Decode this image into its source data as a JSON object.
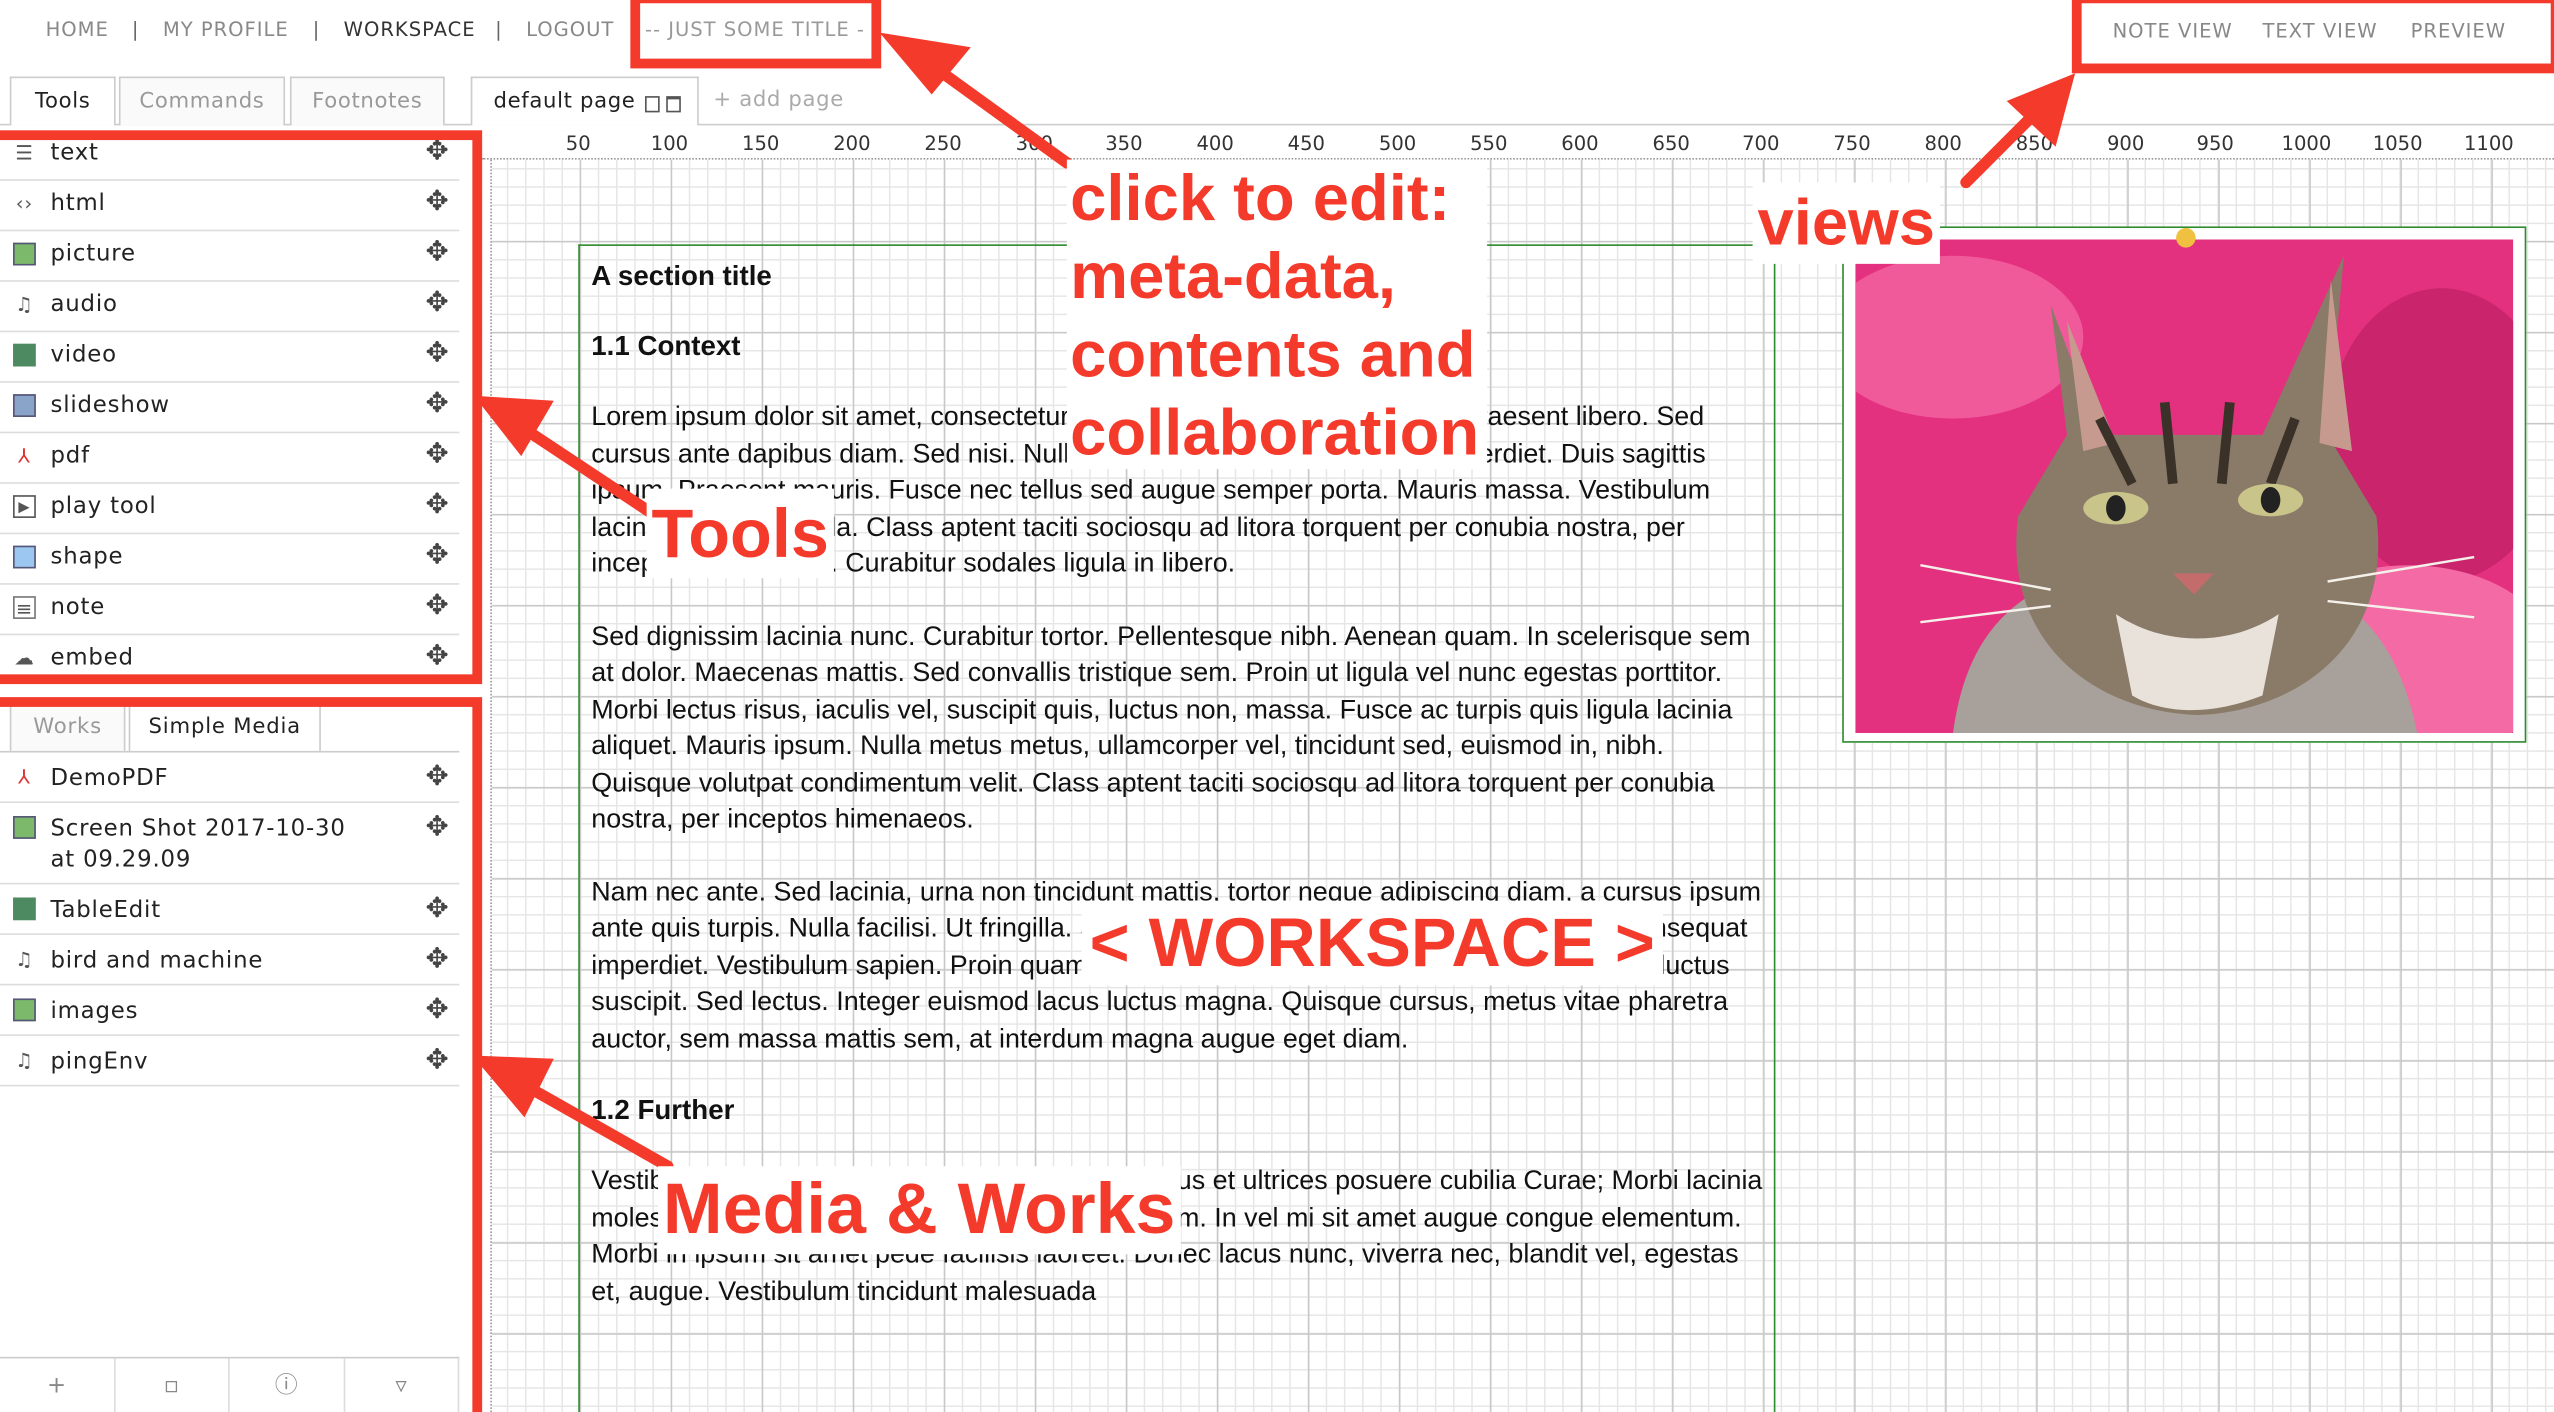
{
  "nav": {
    "home": "HOME",
    "my_profile": "MY PROFILE",
    "workspace": "WORKSPACE",
    "logout": "LOGOUT",
    "separator": "|",
    "title": "-- JUST SOME TITLE -"
  },
  "views": {
    "note_view": "NOTE VIEW",
    "text_view": "TEXT VIEW",
    "preview": "PREVIEW"
  },
  "sidebar_tabs": [
    "Tools",
    "Commands",
    "Footnotes"
  ],
  "page_tabs": {
    "current": "default page",
    "add": "+ add page"
  },
  "tools": [
    {
      "label": "text",
      "icon": "text-icon"
    },
    {
      "label": "html",
      "icon": "html-icon"
    },
    {
      "label": "picture",
      "icon": "picture-icon"
    },
    {
      "label": "audio",
      "icon": "audio-icon"
    },
    {
      "label": "video",
      "icon": "video-icon"
    },
    {
      "label": "slideshow",
      "icon": "slideshow-icon"
    },
    {
      "label": "pdf",
      "icon": "pdf-icon"
    },
    {
      "label": "play tool",
      "icon": "play-icon"
    },
    {
      "label": "shape",
      "icon": "shape-icon"
    },
    {
      "label": "note",
      "icon": "note-icon"
    },
    {
      "label": "embed",
      "icon": "embed-icon"
    }
  ],
  "media_tabs": [
    "Works",
    "Simple Media"
  ],
  "media": [
    {
      "label": "DemoPDF",
      "icon": "pdf-icon"
    },
    {
      "label": "Screen Shot 2017-10-30 at 09.29.09",
      "icon": "picture-icon"
    },
    {
      "label": "TableEdit",
      "icon": "video-icon"
    },
    {
      "label": "bird and machine",
      "icon": "audio-icon"
    },
    {
      "label": "images",
      "icon": "picture-icon"
    },
    {
      "label": "pingEnv",
      "icon": "audio-icon"
    }
  ],
  "ruler_ticks": [
    "50",
    "100",
    "150",
    "200",
    "250",
    "300",
    "350",
    "400",
    "450",
    "500",
    "550",
    "600",
    "650",
    "700",
    "750",
    "800",
    "850",
    "900",
    "950",
    "1000",
    "1050",
    "1100"
  ],
  "document": {
    "section_title": "A section title",
    "subsection_1": "1.1 Context",
    "paragraph_1": "Lorem ipsum dolor sit amet, consectetur adipiscing elit. Integer nec odio. Praesent libero. Sed cursus ante dapibus diam. Sed nisi. Nulla quis sem at nibh elementum imperdiet. Duis sagittis ipsum. Praesent mauris. Fusce nec tellus sed augue semper porta. Mauris massa. Vestibulum lacinia arcu eget nulla. Class aptent taciti sociosqu ad litora torquent per conubia nostra, per inceptos himenaeos. Curabitur sodales ligula in libero.",
    "paragraph_2": "Sed dignissim lacinia nunc. Curabitur tortor. Pellentesque nibh. Aenean quam. In scelerisque sem at dolor. Maecenas mattis. Sed convallis tristique sem. Proin ut ligula vel nunc egestas porttitor. Morbi lectus risus, iaculis vel, suscipit quis, luctus non, massa. Fusce ac turpis quis ligula lacinia aliquet. Mauris ipsum. Nulla metus metus, ullamcorper vel, tincidunt sed, euismod in, nibh. Quisque volutpat condimentum velit. Class aptent taciti sociosqu ad litora torquent per conubia nostra, per inceptos himenaeos.",
    "paragraph_3": "Nam nec ante. Sed lacinia, urna non tincidunt mattis, tortor neque adipiscing diam, a cursus ipsum ante quis turpis. Nulla facilisi. Ut fringilla. Suspendisse potenti. Nunc feugiat mi a tellus consequat imperdiet. Vestibulum sapien. Proin quam. Etiam ultrices. Suspendisse in justo eu magna luctus suscipit. Sed lectus. Integer euismod lacus luctus magna. Quisque cursus, metus vitae pharetra auctor, sem massa mattis sem, at interdum magna augue eget diam.",
    "subsection_2": "1.2 Further",
    "paragraph_4": "Vestibulum ante ipsum primis in faucibus orci luctus et ultrices posuere cubilia Curae; Morbi lacinia molestie dui. Praesent blandit dolor. Sed non quam. In vel mi sit amet augue congue elementum. Morbi in ipsum sit amet pede facilisis laoreet. Donec lacus nunc, viverra nec, blandit vel, egestas et, augue. Vestibulum tincidunt malesuada"
  },
  "annotations": {
    "edit": "click to edit:\nmeta-data,\ncontents and\ncollaboration",
    "views": "views",
    "tools": "Tools",
    "workspace": "< WORKSPACE >",
    "media": "Media & Works"
  },
  "colors": {
    "annotation_red": "#f43a2b",
    "frame_green": "#2e8b2e",
    "cat_background": "#e4317f"
  }
}
